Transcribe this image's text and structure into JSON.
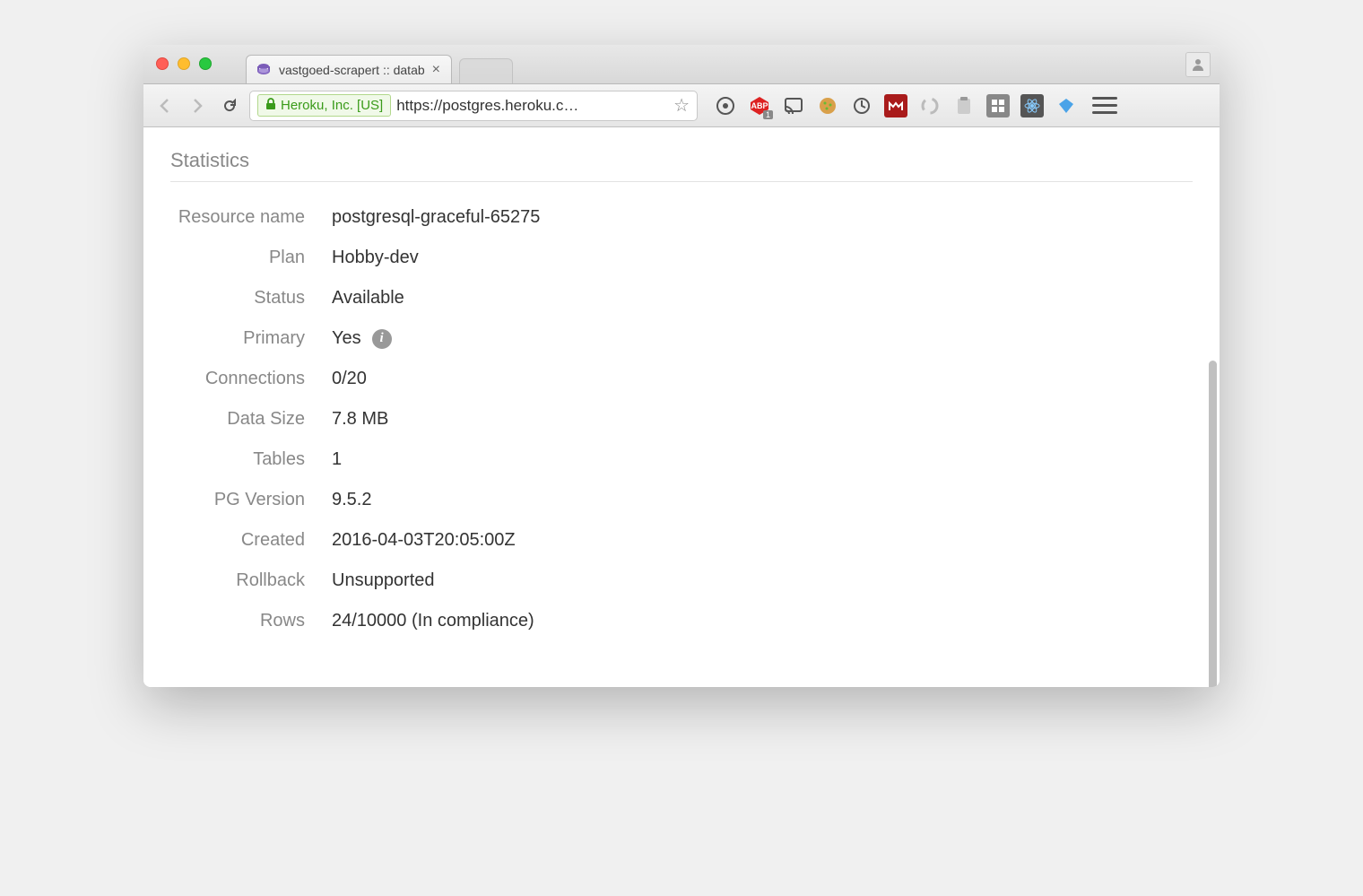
{
  "browser": {
    "tab_title": "vastgoed-scrapert :: datab",
    "ssl_org": "Heroku, Inc. [US]",
    "url": "https://postgres.heroku.c…"
  },
  "page": {
    "section_title": "Statistics",
    "stats": [
      {
        "label": "Resource name",
        "value": "postgresql-graceful-65275",
        "info": false
      },
      {
        "label": "Plan",
        "value": "Hobby-dev",
        "info": false
      },
      {
        "label": "Status",
        "value": "Available",
        "info": false
      },
      {
        "label": "Primary",
        "value": "Yes",
        "info": true
      },
      {
        "label": "Connections",
        "value": "0/20",
        "info": false
      },
      {
        "label": "Data Size",
        "value": "7.8 MB",
        "info": false
      },
      {
        "label": "Tables",
        "value": "1",
        "info": false
      },
      {
        "label": "PG Version",
        "value": "9.5.2",
        "info": false
      },
      {
        "label": "Created",
        "value": "2016-04-03T20:05:00Z",
        "info": false
      },
      {
        "label": "Rollback",
        "value": "Unsupported",
        "info": false
      },
      {
        "label": "Rows",
        "value": "24/10000 (In compliance)",
        "info": false
      }
    ]
  }
}
